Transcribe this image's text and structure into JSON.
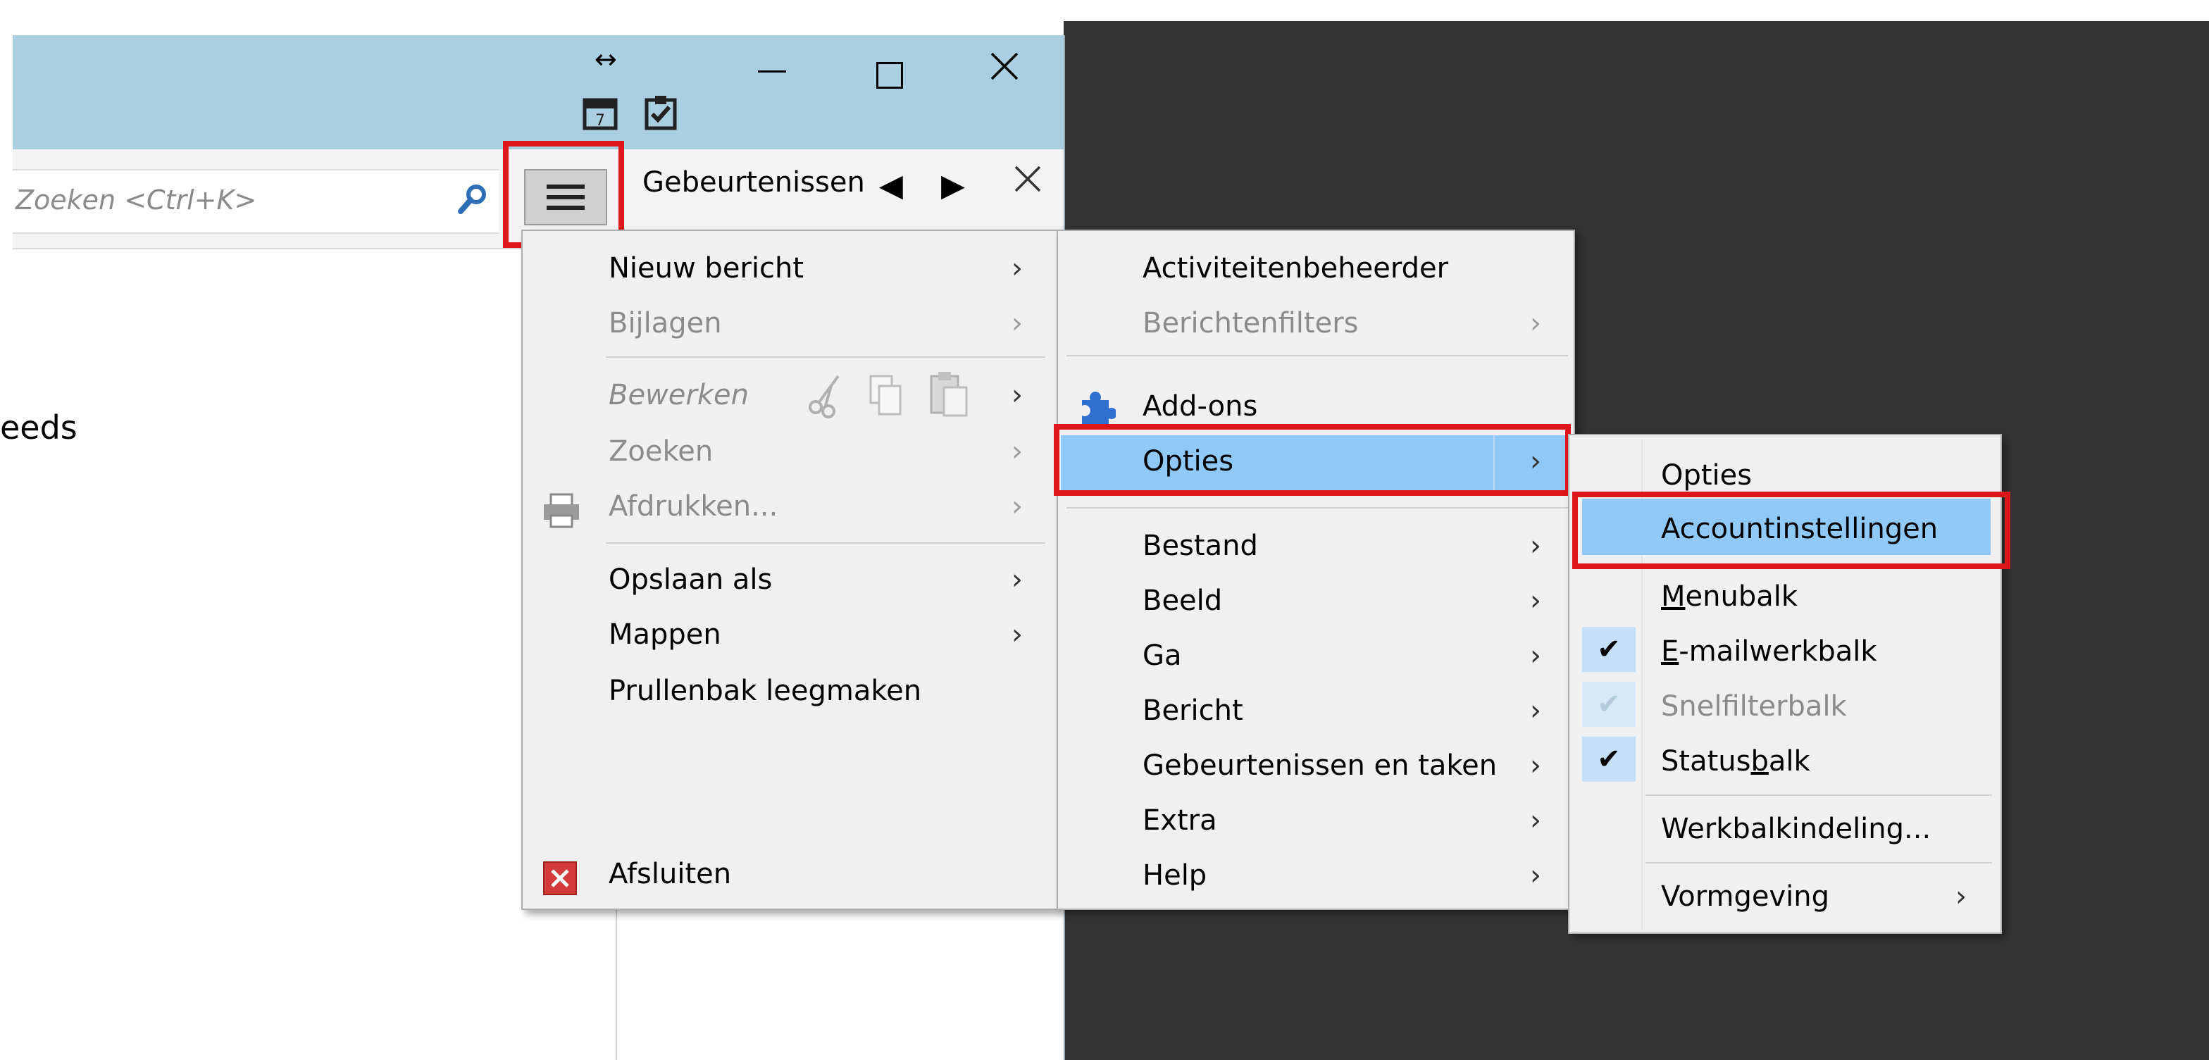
{
  "window": {
    "search_placeholder": "Zoeken <Ctrl+K>",
    "events_label": "Gebeurtenissen",
    "left_partial_text": "eeds"
  },
  "app_menu": {
    "items": [
      {
        "label": "Nieuw bericht"
      },
      {
        "label": "Bijlagen"
      },
      {
        "label": "Bewerken"
      },
      {
        "label": "Zoeken"
      },
      {
        "label": "Afdrukken..."
      },
      {
        "label": "Opslaan als"
      },
      {
        "label": "Mappen"
      },
      {
        "label": "Prullenbak leegmaken"
      },
      {
        "label": "Afsluiten"
      }
    ]
  },
  "sub_menu": {
    "items": [
      {
        "label": "Activiteitenbeheerder"
      },
      {
        "label": "Berichtenfilters"
      },
      {
        "label": "Add-ons"
      },
      {
        "label": "Opties"
      },
      {
        "label": "Bestand"
      },
      {
        "label": "Beeld"
      },
      {
        "label": "Ga"
      },
      {
        "label": "Bericht"
      },
      {
        "label": "Gebeurtenissen en taken"
      },
      {
        "label": "Extra"
      },
      {
        "label": "Help"
      }
    ]
  },
  "options_menu": {
    "items": [
      {
        "label": "Opties"
      },
      {
        "label": "Accountinstellingen"
      },
      {
        "label": "Werkbalkindeling..."
      },
      {
        "label": "Vormgeving"
      }
    ],
    "menubalk": {
      "u": "M",
      "rest": "enubalk"
    },
    "emailwerkbalk": {
      "u": "E",
      "rest": "-mailwerkbalk"
    },
    "snelfilterbalk": "Snelfilterbalk",
    "statusbalk": {
      "pre": "Status",
      "u": "b",
      "rest": "alk"
    }
  },
  "colors": {
    "highlight": "#90c8f6",
    "annotation_red": "#e0141b",
    "titlebar": "#aacfe0"
  }
}
